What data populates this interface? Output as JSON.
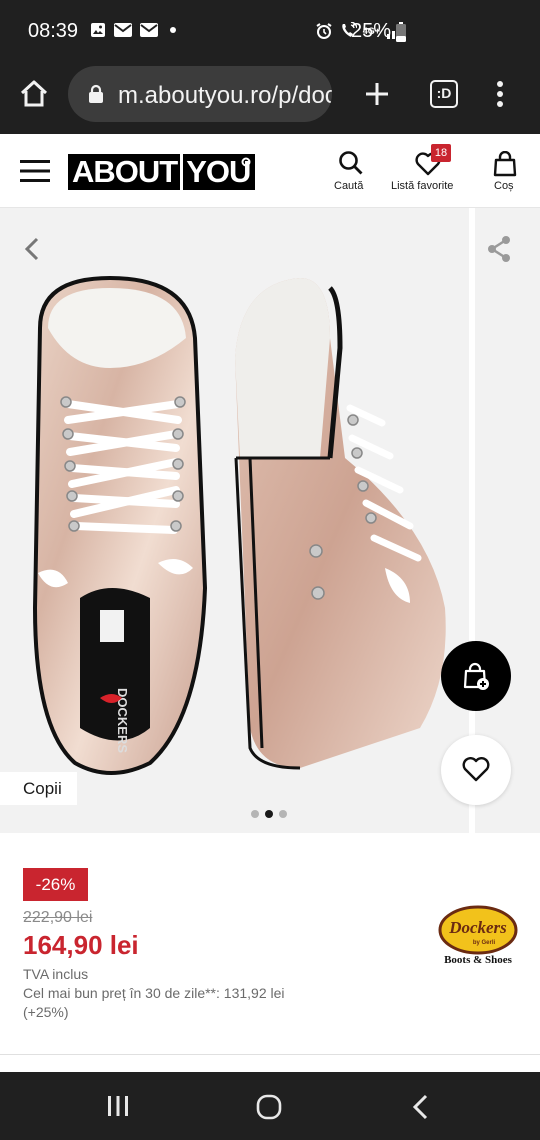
{
  "status_bar": {
    "time": "08:39",
    "battery": "25%",
    "network": "4G+",
    "icons": [
      "image-icon",
      "mail-icon",
      "mail-icon",
      "dot-icon",
      "alarm-icon",
      "wifi-call-icon",
      "signal-icon",
      "battery-icon"
    ]
  },
  "browser": {
    "url": "m.aboutyou.ro/p/dockers",
    "tab_icon_label": ":D",
    "icons": [
      "home-icon",
      "lock-icon",
      "plus-icon",
      "tabs-icon",
      "more-vert-icon"
    ]
  },
  "header": {
    "logo_left": "ABOUT",
    "logo_right": "YOU",
    "search_label": "Caută",
    "favorites_label": "Listă favorite",
    "favorites_count": "18",
    "cart_label": "Coș",
    "accent_color": "#c9252f"
  },
  "gallery": {
    "tag": "Copii",
    "total_images": 3,
    "active_image": 2,
    "icons": [
      "back-chevron-icon",
      "share-icon",
      "add-to-cart-icon",
      "heart-icon"
    ]
  },
  "product": {
    "discount": "-26%",
    "old_price": "222,90 lei",
    "price": "164,90 lei",
    "vat": "TVA inclus",
    "best_price_text": "Cel mai bun preț în 30 de zile**: 131,92 lei (+25%)",
    "brand_name": "Dockers",
    "brand_by": "by Gerli",
    "brand_tagline": "Boots & Shoes"
  },
  "nav_bar": {
    "icons": [
      "recents-icon",
      "home-circle-icon",
      "back-icon"
    ]
  }
}
